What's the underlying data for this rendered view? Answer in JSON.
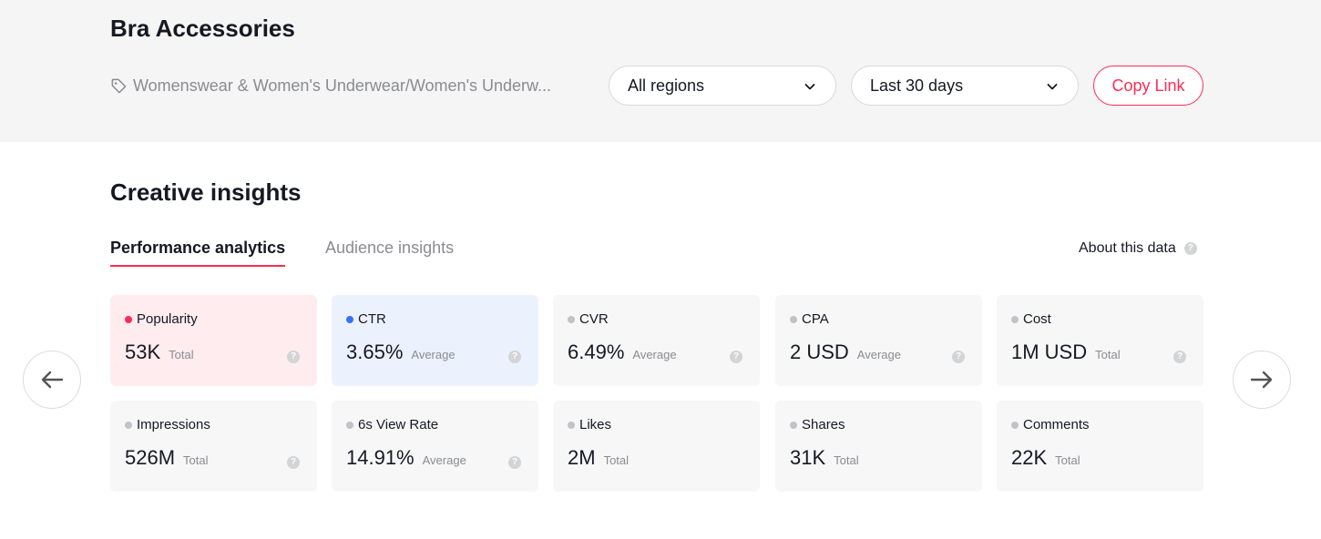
{
  "header": {
    "title": "Bra Accessories",
    "category": "Womenswear & Women's Underwear/Women's Underw...",
    "region_select": "All regions",
    "date_select": "Last 30 days",
    "copy_link": "Copy Link",
    "accent_color": "#fe2c55"
  },
  "section": {
    "title": "Creative insights",
    "tabs": [
      {
        "label": "Performance analytics",
        "active": true
      },
      {
        "label": "Audience insights",
        "active": false
      }
    ],
    "about": "About this data"
  },
  "metrics": [
    {
      "label": "Popularity",
      "value": "53K",
      "qualifier": "Total",
      "dot": "red",
      "card": "pink"
    },
    {
      "label": "CTR",
      "value": "3.65%",
      "qualifier": "Average",
      "dot": "blue",
      "card": "blue"
    },
    {
      "label": "CVR",
      "value": "6.49%",
      "qualifier": "Average",
      "dot": "grey",
      "card": "grey"
    },
    {
      "label": "CPA",
      "value": "2 USD",
      "qualifier": "Average",
      "dot": "grey",
      "card": "grey"
    },
    {
      "label": "Cost",
      "value": "1M USD",
      "qualifier": "Total",
      "dot": "grey",
      "card": "grey"
    },
    {
      "label": "Impressions",
      "value": "526M",
      "qualifier": "Total",
      "dot": "grey",
      "card": "grey"
    },
    {
      "label": "6s View Rate",
      "value": "14.91%",
      "qualifier": "Average",
      "dot": "grey",
      "card": "grey"
    },
    {
      "label": "Likes",
      "value": "2M",
      "qualifier": "Total",
      "dot": "grey",
      "card": "grey"
    },
    {
      "label": "Shares",
      "value": "31K",
      "qualifier": "Total",
      "dot": "grey",
      "card": "grey"
    },
    {
      "label": "Comments",
      "value": "22K",
      "qualifier": "Total",
      "dot": "grey",
      "card": "grey"
    }
  ],
  "icons": {
    "help": "?",
    "prev": "arrow-left-icon",
    "next": "arrow-right-icon"
  }
}
